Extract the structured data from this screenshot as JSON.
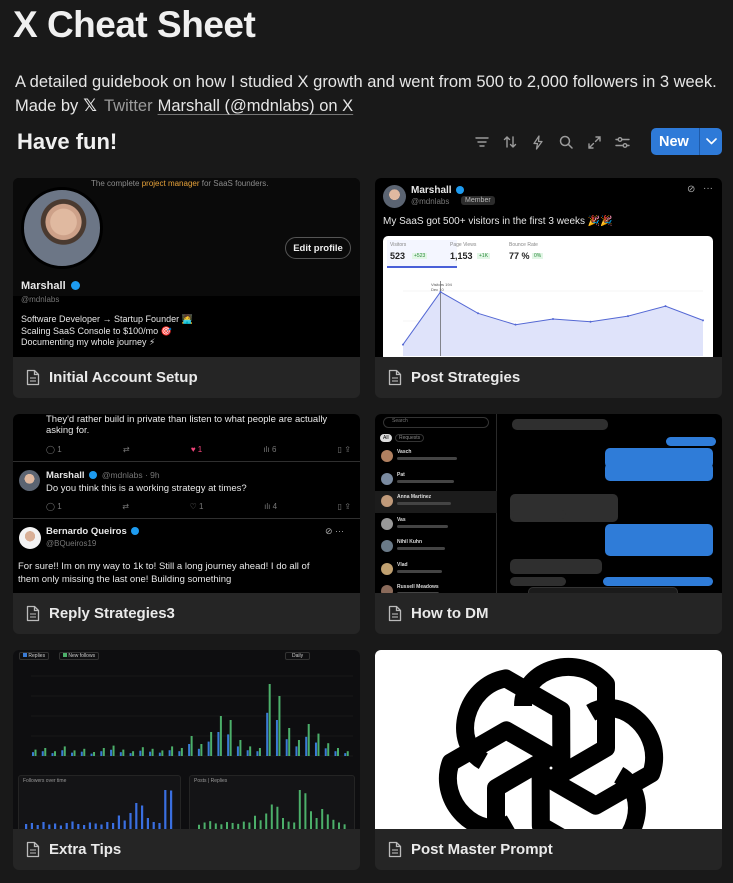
{
  "page": {
    "title": "X Cheat Sheet",
    "description": "A detailed guidebook on how I studied X growth and went from 500 to 2,000 followers in 3 week.",
    "made_by": "Made by",
    "twitter_word": "Twitter",
    "author_link": "Marshall (@mdnlabs) on X"
  },
  "view": {
    "title": "Have fun!",
    "new_label": "New",
    "tools": [
      "filter-icon",
      "sort-icon",
      "automation-icon",
      "search-icon",
      "expand-icon",
      "settings-icon"
    ]
  },
  "cards": [
    {
      "name": "Initial Account Setup",
      "preview": {
        "banner_text_1": "The complete",
        "banner_highlight": "project manager",
        "banner_text_2": "for SaaS founders.",
        "edit_profile": "Edit profile",
        "display_name": "Marshall",
        "handle": "@mdnlabs",
        "bio": [
          "Software Developer → Startup Founder 🧑‍💻",
          "Scaling SaaS Console to $100/mo 🎯",
          "Documenting my whole journey ⚡"
        ]
      }
    },
    {
      "name": "Post Strategies",
      "preview": {
        "display_name": "Marshall",
        "handle": "@mdnlabs",
        "member_badge": "Member",
        "post_text": "My SaaS got 500+ visitors in the first 3 weeks 🎉🎉",
        "stats": [
          {
            "label": "Visitors",
            "value": "523",
            "delta": "+523"
          },
          {
            "label": "Page Views",
            "value": "1,153",
            "delta": "+1K"
          },
          {
            "label": "Bounce Rate",
            "value": "77 %",
            "delta": "0%"
          }
        ],
        "tooltip_label": "Visitors",
        "tooltip_value": "194",
        "tooltip_date": "Dec 10",
        "chart_values": [
          0.08,
          0.45,
          0.3,
          0.22,
          0.26,
          0.24,
          0.28,
          0.35,
          0.25
        ]
      }
    },
    {
      "name": "Reply Strategies3",
      "preview": {
        "quote_text": "They'd rather build in private than listen to what people are actually asking for.",
        "reply1_name": "Marshall",
        "reply1_meta": "@mdnlabs · 9h",
        "reply1_text": "Do you think this is a working strategy at times?",
        "reply2_name": "Bernardo Queiros",
        "reply2_handle": "@BQueiros19",
        "reply2_text_1": "For sure!! Im on my way to 1k to! Still a long journey ahead! I do all of",
        "reply2_text_2": "them only missing the last one! Building something",
        "counts": [
          "1",
          "1",
          "6",
          "1",
          "1",
          "4"
        ]
      }
    },
    {
      "name": "How to DM",
      "preview": {
        "search_placeholder": "Search",
        "tabs": [
          "All",
          "Requests"
        ],
        "threads": [
          "Vasch",
          "Pat",
          "Anna Martinez",
          "Vas",
          "Nihil Kuhn",
          "Vlad",
          "Russell Meadows"
        ]
      }
    },
    {
      "name": "Extra Tips",
      "preview": {
        "legend": [
          "Replies",
          "New follows"
        ],
        "period": "Daily",
        "bar_values": [
          0.08,
          0.1,
          0.06,
          0.12,
          0.07,
          0.09,
          0.05,
          0.1,
          0.13,
          0.08,
          0.06,
          0.11,
          0.09,
          0.07,
          0.12,
          0.1,
          0.25,
          0.15,
          0.3,
          0.5,
          0.45,
          0.2,
          0.12,
          0.1,
          0.9,
          0.75,
          0.35,
          0.2,
          0.4,
          0.28,
          0.16,
          0.1,
          0.06
        ],
        "sub_chart_1_title": "Followers over time",
        "sub_chart_2_legend": [
          "Posts",
          "Replies"
        ]
      }
    },
    {
      "name": "Post Master Prompt",
      "preview": {
        "logo": "openai-logo"
      }
    }
  ],
  "colors": {
    "accent": "#2e7ad8",
    "background": "#191919",
    "card": "#252525",
    "verified": "#1d9bf0",
    "dm_bubble": "#2f7cd8"
  }
}
